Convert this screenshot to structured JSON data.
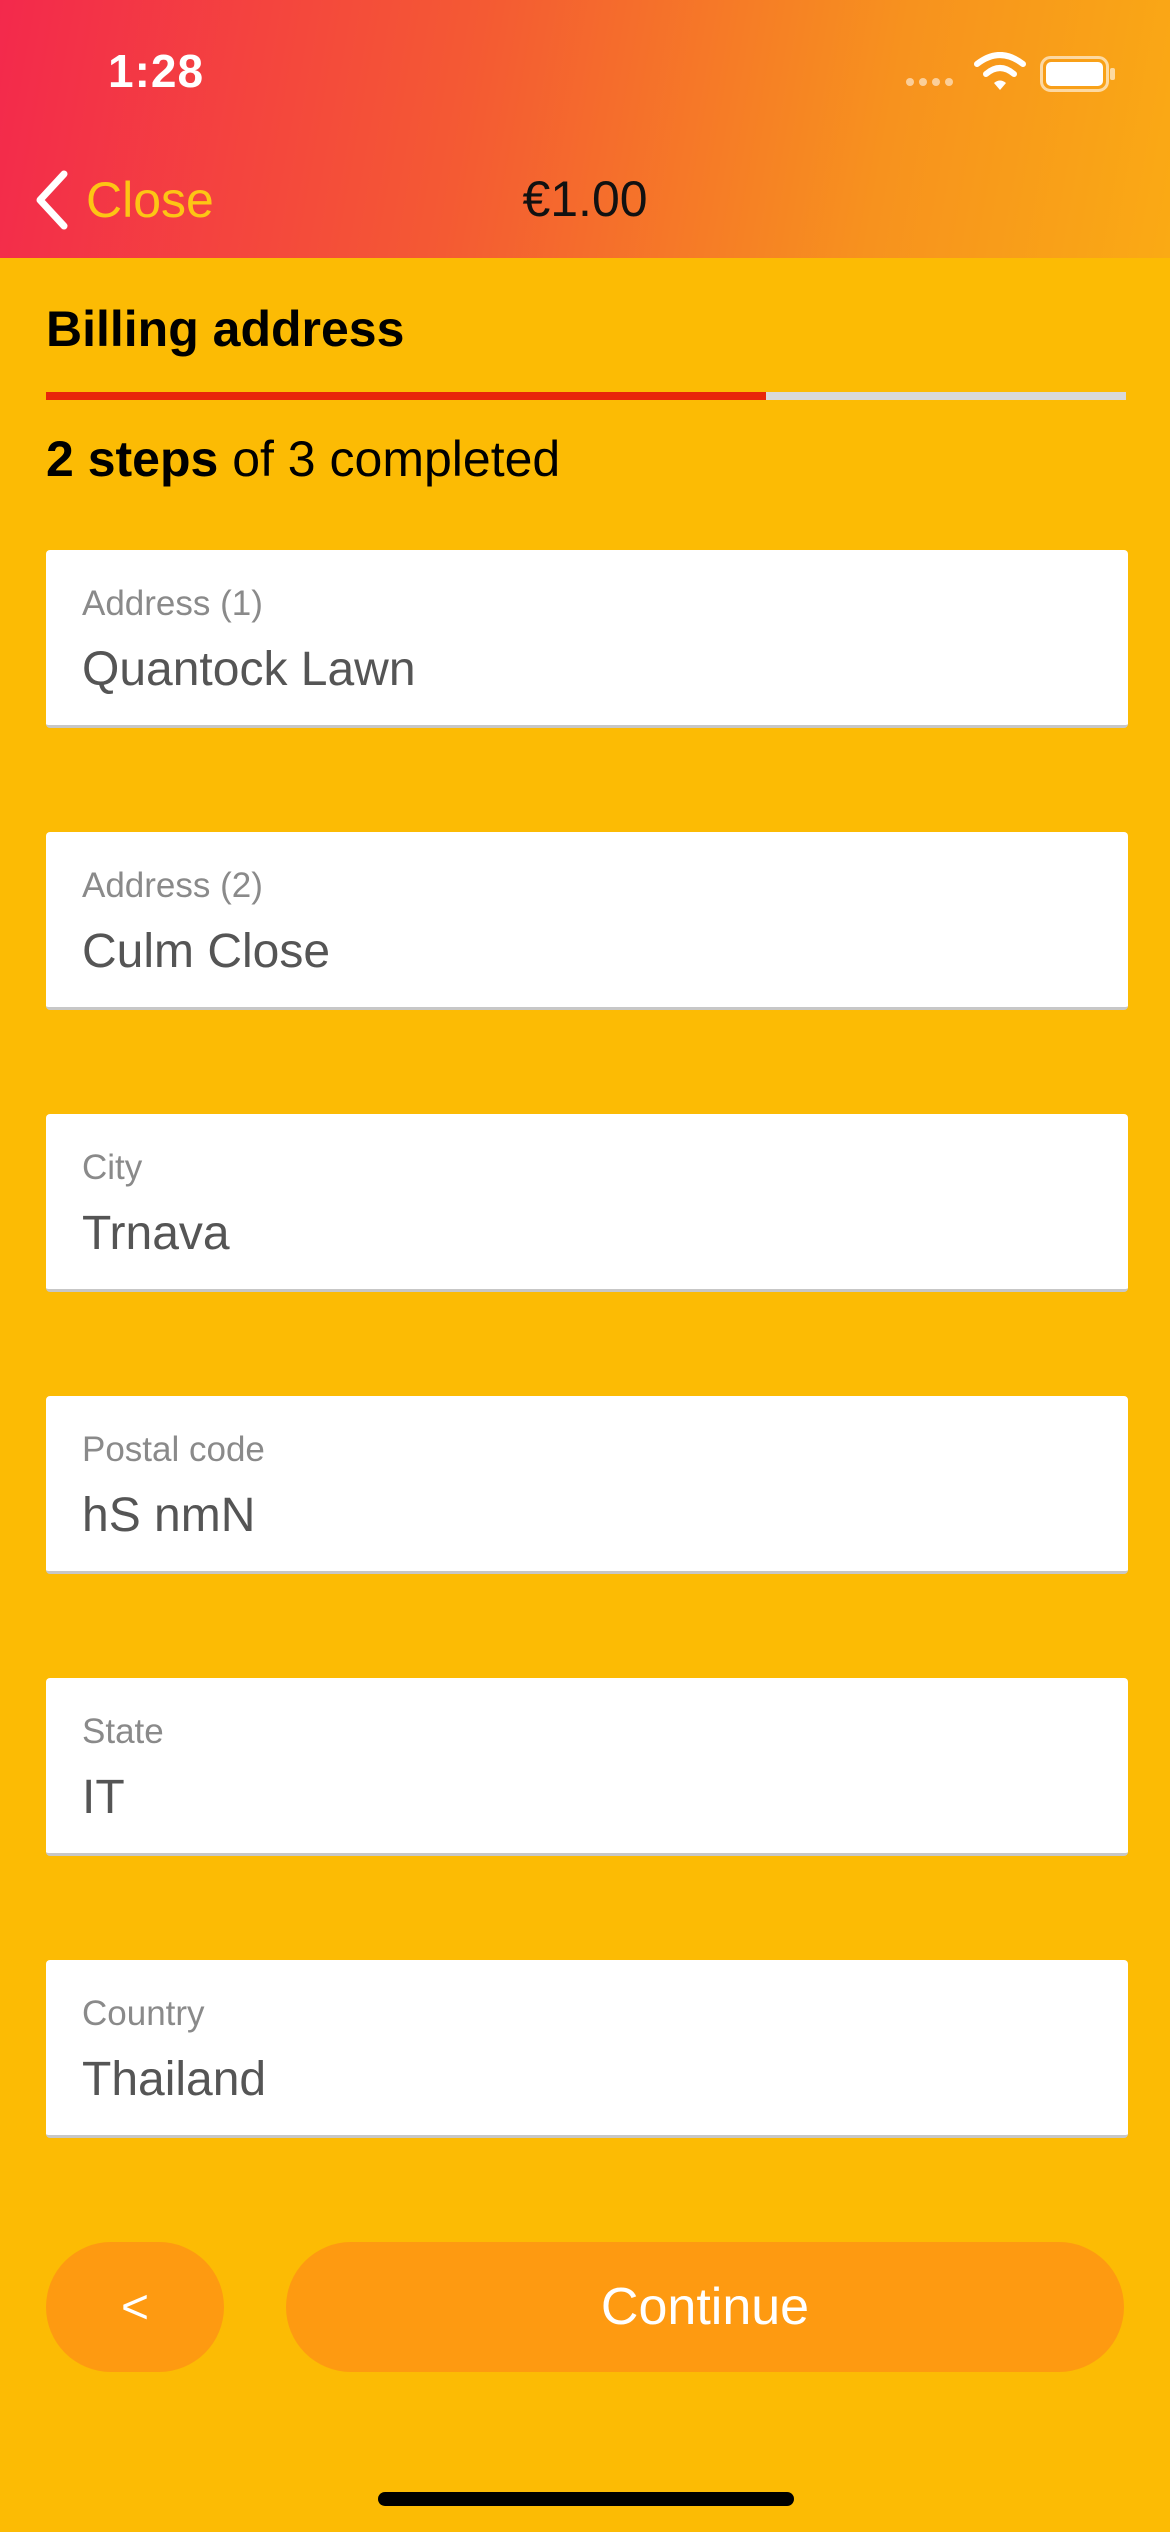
{
  "status_bar": {
    "time": "1:28"
  },
  "nav": {
    "back_label": "Close",
    "amount": "€1.00"
  },
  "step": {
    "title": "Billing address",
    "steps_count": "2 steps",
    "steps_rest": " of 3 completed",
    "progress_fraction": 0.667
  },
  "fields": [
    {
      "label": "Address (1)",
      "value": "Quantock Lawn"
    },
    {
      "label": "Address (2)",
      "value": "Culm Close"
    },
    {
      "label": "City",
      "value": "Trnava"
    },
    {
      "label": "Postal code",
      "value": "hS nmN"
    },
    {
      "label": "State",
      "value": "IT"
    },
    {
      "label": "Country",
      "value": "Thailand"
    }
  ],
  "buttons": {
    "prev_label": "<",
    "continue_label": "Continue"
  },
  "colors": {
    "background": "#FCBB04",
    "progress_fill": "#E8260A",
    "progress_track": "#D9D9D9",
    "button": "#FE9A11",
    "back_accent": "#FDC514"
  }
}
